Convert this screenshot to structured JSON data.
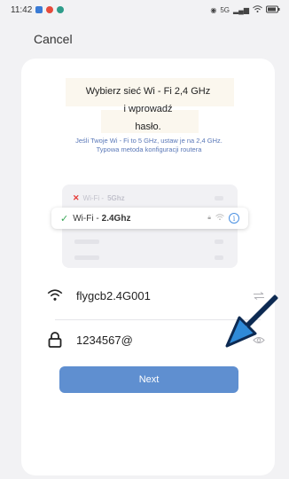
{
  "status_bar": {
    "time": "11:42",
    "network": "5G",
    "colors": {
      "app1": "#3a7bd5",
      "app2": "#e64a3b",
      "app3": "#2e9c8a"
    }
  },
  "header": {
    "cancel_label": "Cancel"
  },
  "instructions": {
    "title_line1": "Wybierz sieć Wi - Fi 2,4 GHz",
    "title_line2": "i wprowadź",
    "title_line3": "hasło.",
    "note_line1": "Jeśli Twoje Wi - Fi to 5 GHz, ustaw je na 2,4 GHz.",
    "note_line2": "Typowa metoda konfiguracji routera"
  },
  "illustration": {
    "wrong_band_prefix": "Wi-Fi - ",
    "wrong_band": "5Ghz",
    "right_band_prefix": "Wi-Fi - ",
    "right_band": "2.4Ghz"
  },
  "form": {
    "ssid_value": "flygcb2.4G001",
    "password_value": "1234567@",
    "next_label": "Next"
  },
  "colors": {
    "accent": "#5f8fd0",
    "arrow": "#2f8ad8",
    "success": "#3aa757",
    "error": "#e53935"
  }
}
